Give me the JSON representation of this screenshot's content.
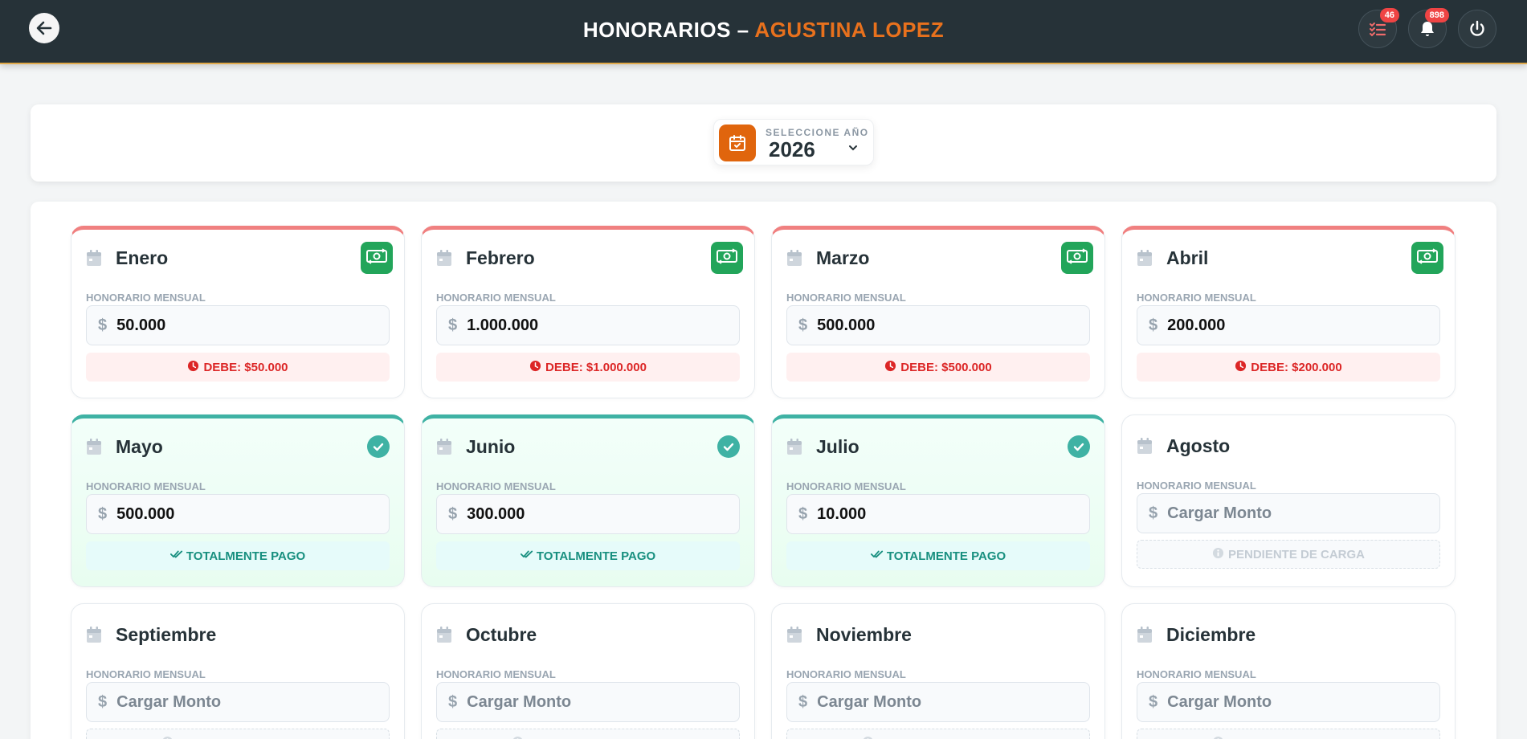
{
  "header": {
    "title_prefix": "HONORARIOS –",
    "client_name": "AGUSTINA LOPEZ",
    "tasks_badge": "46",
    "notifications_badge": "898"
  },
  "year_selector": {
    "label": "SELECCIONE AÑO",
    "value": "2026"
  },
  "common": {
    "fee_label": "HONORARIO MENSUAL",
    "currency_symbol": "$",
    "amount_placeholder": "Cargar Monto",
    "paid_text": "TOTALMENTE PAGO",
    "pending_text": "PENDIENTE DE CARGA"
  },
  "colors": {
    "header_bg": "#263238",
    "accent_orange": "#e8711d",
    "owed_red": "#f08080",
    "paid_teal": "#3fb2a4",
    "pay_button_green": "#22a55a"
  },
  "months": [
    {
      "name": "Enero",
      "status": "owed",
      "amount": "50.000",
      "debt": "DEBE: $50.000"
    },
    {
      "name": "Febrero",
      "status": "owed",
      "amount": "1.000.000",
      "debt": "DEBE: $1.000.000"
    },
    {
      "name": "Marzo",
      "status": "owed",
      "amount": "500.000",
      "debt": "DEBE: $500.000"
    },
    {
      "name": "Abril",
      "status": "owed",
      "amount": "200.000",
      "debt": "DEBE: $200.000"
    },
    {
      "name": "Mayo",
      "status": "paid",
      "amount": "500.000"
    },
    {
      "name": "Junio",
      "status": "paid",
      "amount": "300.000"
    },
    {
      "name": "Julio",
      "status": "paid",
      "amount": "10.000"
    },
    {
      "name": "Agosto",
      "status": "pending"
    },
    {
      "name": "Septiembre",
      "status": "pending"
    },
    {
      "name": "Octubre",
      "status": "pending"
    },
    {
      "name": "Noviembre",
      "status": "pending"
    },
    {
      "name": "Diciembre",
      "status": "pending"
    }
  ]
}
